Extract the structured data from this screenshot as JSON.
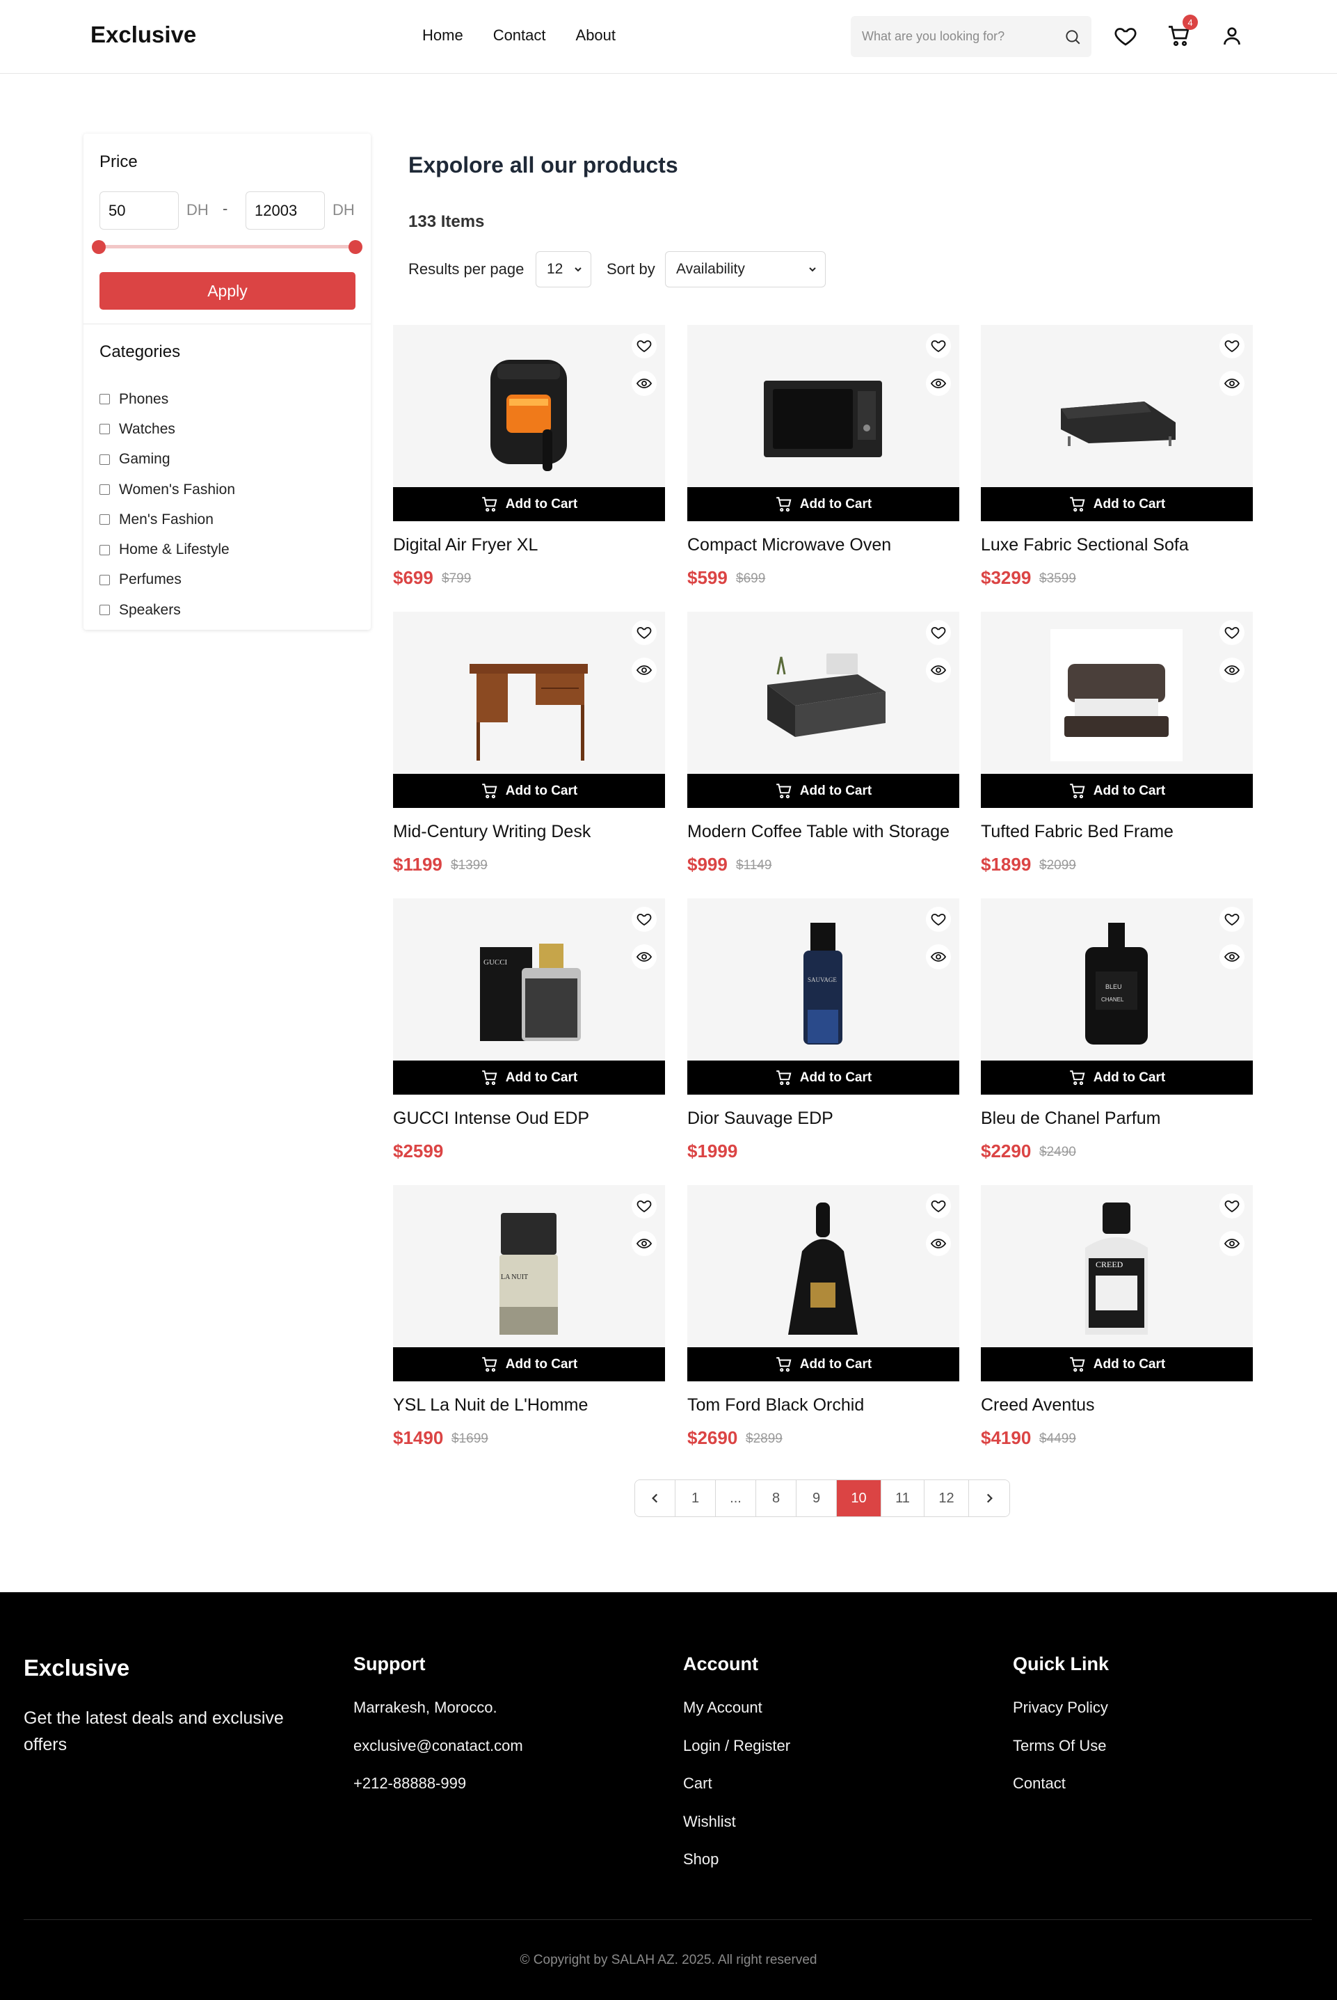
{
  "header": {
    "logo": "Exclusive",
    "nav": [
      "Home",
      "Contact",
      "About"
    ],
    "search_placeholder": "What are you looking for?",
    "cart_count": "4"
  },
  "sidebar": {
    "price_title": "Price",
    "price_min": "50",
    "price_max": "12003",
    "currency": "DH",
    "separator": "-",
    "apply_label": "Apply",
    "categories_title": "Categories",
    "categories": [
      "Phones",
      "Watches",
      "Gaming",
      "Women's Fashion",
      "Men's Fashion",
      "Home & Lifestyle",
      "Perfumes",
      "Speakers"
    ]
  },
  "main": {
    "title": "Expolore all our products",
    "item_count": "133 Items",
    "results_label": "Results per page",
    "results_value": "12",
    "sort_label": "Sort by",
    "sort_value": "Availability",
    "add_to_cart_label": "Add to Cart"
  },
  "products": [
    {
      "name": "Digital Air Fryer XL",
      "price": "$699",
      "old_price": "$799",
      "icon": "air-fryer"
    },
    {
      "name": "Compact Microwave Oven",
      "price": "$599",
      "old_price": "$699",
      "icon": "microwave"
    },
    {
      "name": "Luxe Fabric Sectional Sofa",
      "price": "$3299",
      "old_price": "$3599",
      "icon": "sofa"
    },
    {
      "name": "Mid-Century Writing Desk",
      "price": "$1199",
      "old_price": "$1399",
      "icon": "desk"
    },
    {
      "name": "Modern Coffee Table with Storage",
      "price": "$999",
      "old_price": "$1149",
      "icon": "coffee-table"
    },
    {
      "name": "Tufted Fabric Bed Frame",
      "price": "$1899",
      "old_price": "$2099",
      "icon": "bed"
    },
    {
      "name": "GUCCI Intense Oud EDP",
      "price": "$2599",
      "old_price": "",
      "icon": "perfume-gucci"
    },
    {
      "name": "Dior Sauvage EDP",
      "price": "$1999",
      "old_price": "",
      "icon": "perfume-dior"
    },
    {
      "name": "Bleu de Chanel Parfum",
      "price": "$2290",
      "old_price": "$2490",
      "icon": "perfume-chanel"
    },
    {
      "name": "YSL La Nuit de L'Homme",
      "price": "$1490",
      "old_price": "$1699",
      "icon": "perfume-ysl"
    },
    {
      "name": "Tom Ford Black Orchid",
      "price": "$2690",
      "old_price": "$2899",
      "icon": "perfume-tomford"
    },
    {
      "name": "Creed Aventus",
      "price": "$4190",
      "old_price": "$4499",
      "icon": "perfume-creed"
    }
  ],
  "pagination": {
    "pages": [
      "1",
      "...",
      "8",
      "9",
      "10",
      "11",
      "12"
    ],
    "active": "10"
  },
  "footer": {
    "logo": "Exclusive",
    "tagline": "Get the latest deals and exclusive offers",
    "support_title": "Support",
    "support": [
      "Marrakesh, Morocco.",
      "exclusive@conatact.com",
      "+212-88888-999"
    ],
    "account_title": "Account",
    "account": [
      "My Account",
      "Login / Register",
      "Cart",
      "Wishlist",
      "Shop"
    ],
    "quick_title": "Quick Link",
    "quick": [
      "Privacy Policy",
      "Terms Of Use",
      "Contact"
    ],
    "copyright": "© Copyright by SALAH AZ. 2025. All right reserved"
  },
  "colors": {
    "accent": "#db4444",
    "footer_bg": "#000000",
    "card_bg": "#f5f5f5"
  }
}
